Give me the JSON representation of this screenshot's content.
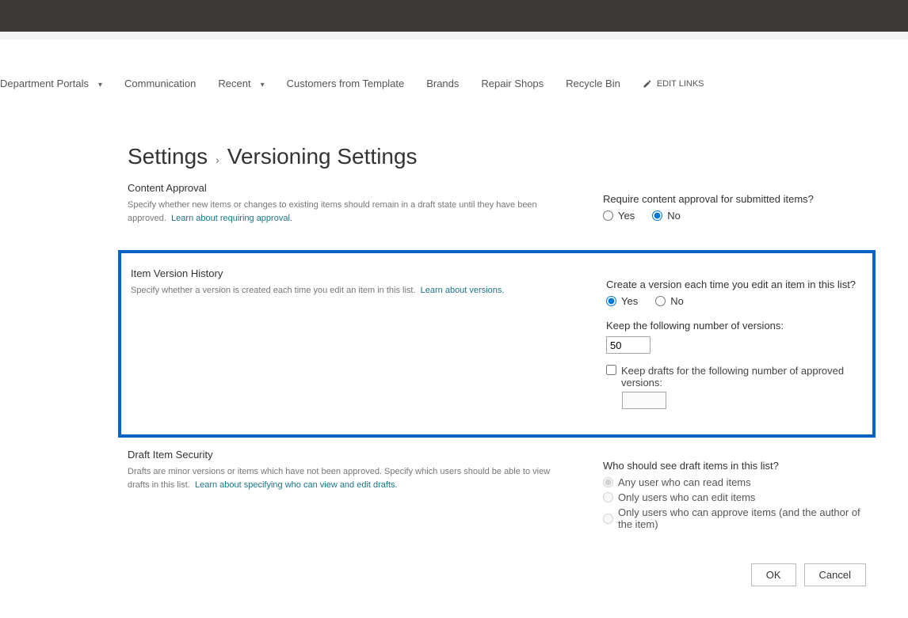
{
  "nav": {
    "items": [
      {
        "label": "Department Portals",
        "has_dropdown": true
      },
      {
        "label": "Communication",
        "has_dropdown": false
      },
      {
        "label": "Recent",
        "has_dropdown": true
      },
      {
        "label": "Customers from Template",
        "has_dropdown": false
      },
      {
        "label": "Brands",
        "has_dropdown": false
      },
      {
        "label": "Repair Shops",
        "has_dropdown": false
      },
      {
        "label": "Recycle Bin",
        "has_dropdown": false
      }
    ],
    "edit_links_label": "EDIT LINKS"
  },
  "breadcrumb": {
    "parent": "Settings",
    "current": "Versioning Settings"
  },
  "content_approval": {
    "title": "Content Approval",
    "desc": "Specify whether new items or changes to existing items should remain in a draft state until they have been approved.",
    "link": "Learn about requiring approval.",
    "question": "Require content approval for submitted items?",
    "yes": "Yes",
    "no": "No",
    "selected": "no"
  },
  "version_history": {
    "title": "Item Version History",
    "desc": "Specify whether a version is created each time you edit an item in this list.",
    "link": "Learn about versions.",
    "question": "Create a version each time you edit an item in this list?",
    "yes": "Yes",
    "no": "No",
    "selected": "yes",
    "keep_versions_label": "Keep the following number of versions:",
    "keep_versions_value": "50",
    "keep_drafts_label": "Keep drafts for the following number of approved versions:",
    "keep_drafts_value": ""
  },
  "draft_security": {
    "title": "Draft Item Security",
    "desc": "Drafts are minor versions or items which have not been approved. Specify which users should be able to view drafts in this list.",
    "link": "Learn about specifying who can view and edit drafts.",
    "question": "Who should see draft items in this list?",
    "options": [
      "Any user who can read items",
      "Only users who can edit items",
      "Only users who can approve items (and the author of the item)"
    ],
    "selected": 0
  },
  "buttons": {
    "ok": "OK",
    "cancel": "Cancel"
  }
}
